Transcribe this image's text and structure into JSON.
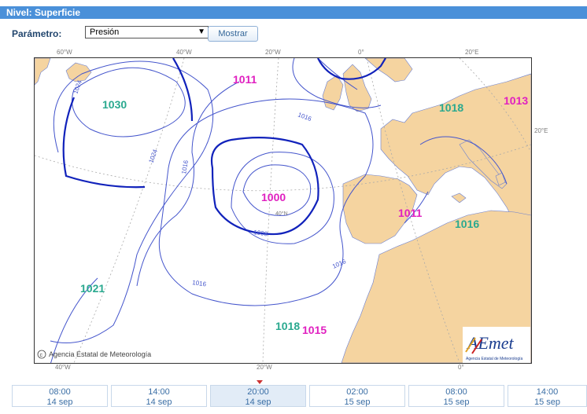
{
  "header": {
    "title": "Nivel: Superficie"
  },
  "form": {
    "param_label": "Parámetro:",
    "param_value": "Presión",
    "show_button": "Mostrar"
  },
  "map": {
    "top_lon_labels": [
      "60°W",
      "40°W",
      "20°W",
      "0°",
      "20°E"
    ],
    "bottom_lon_labels": [
      "40°W",
      "20°W",
      "0°"
    ],
    "right_lat_label": "20°E",
    "lat_label": "40°N",
    "isobar_labels": [
      "1024",
      "1016",
      "1016",
      "1008",
      "1016",
      "1016"
    ],
    "highs": [
      "1030",
      "1021",
      "1018",
      "1018",
      "1016"
    ],
    "lows": [
      "1011",
      "1000",
      "1011",
      "1013",
      "1015"
    ],
    "copyright": "Agencia Estatal de Meteorología",
    "logo_text": "AEmet",
    "logo_sub": "Agencia Estatal de Meteorología",
    "colors": {
      "land": "#f5d4a0",
      "sea": "#ffffff",
      "isobar": "#3344cc",
      "high": "#2aa98f",
      "low": "#e020c0"
    }
  },
  "timeline": [
    {
      "time": "08:00",
      "date": "14 sep"
    },
    {
      "time": "14:00",
      "date": "14 sep"
    },
    {
      "time": "20:00",
      "date": "14 sep",
      "selected": true
    },
    {
      "time": "02:00",
      "date": "15 sep"
    },
    {
      "time": "08:00",
      "date": "15 sep"
    },
    {
      "time": "14:00",
      "date": "15 sep"
    }
  ]
}
